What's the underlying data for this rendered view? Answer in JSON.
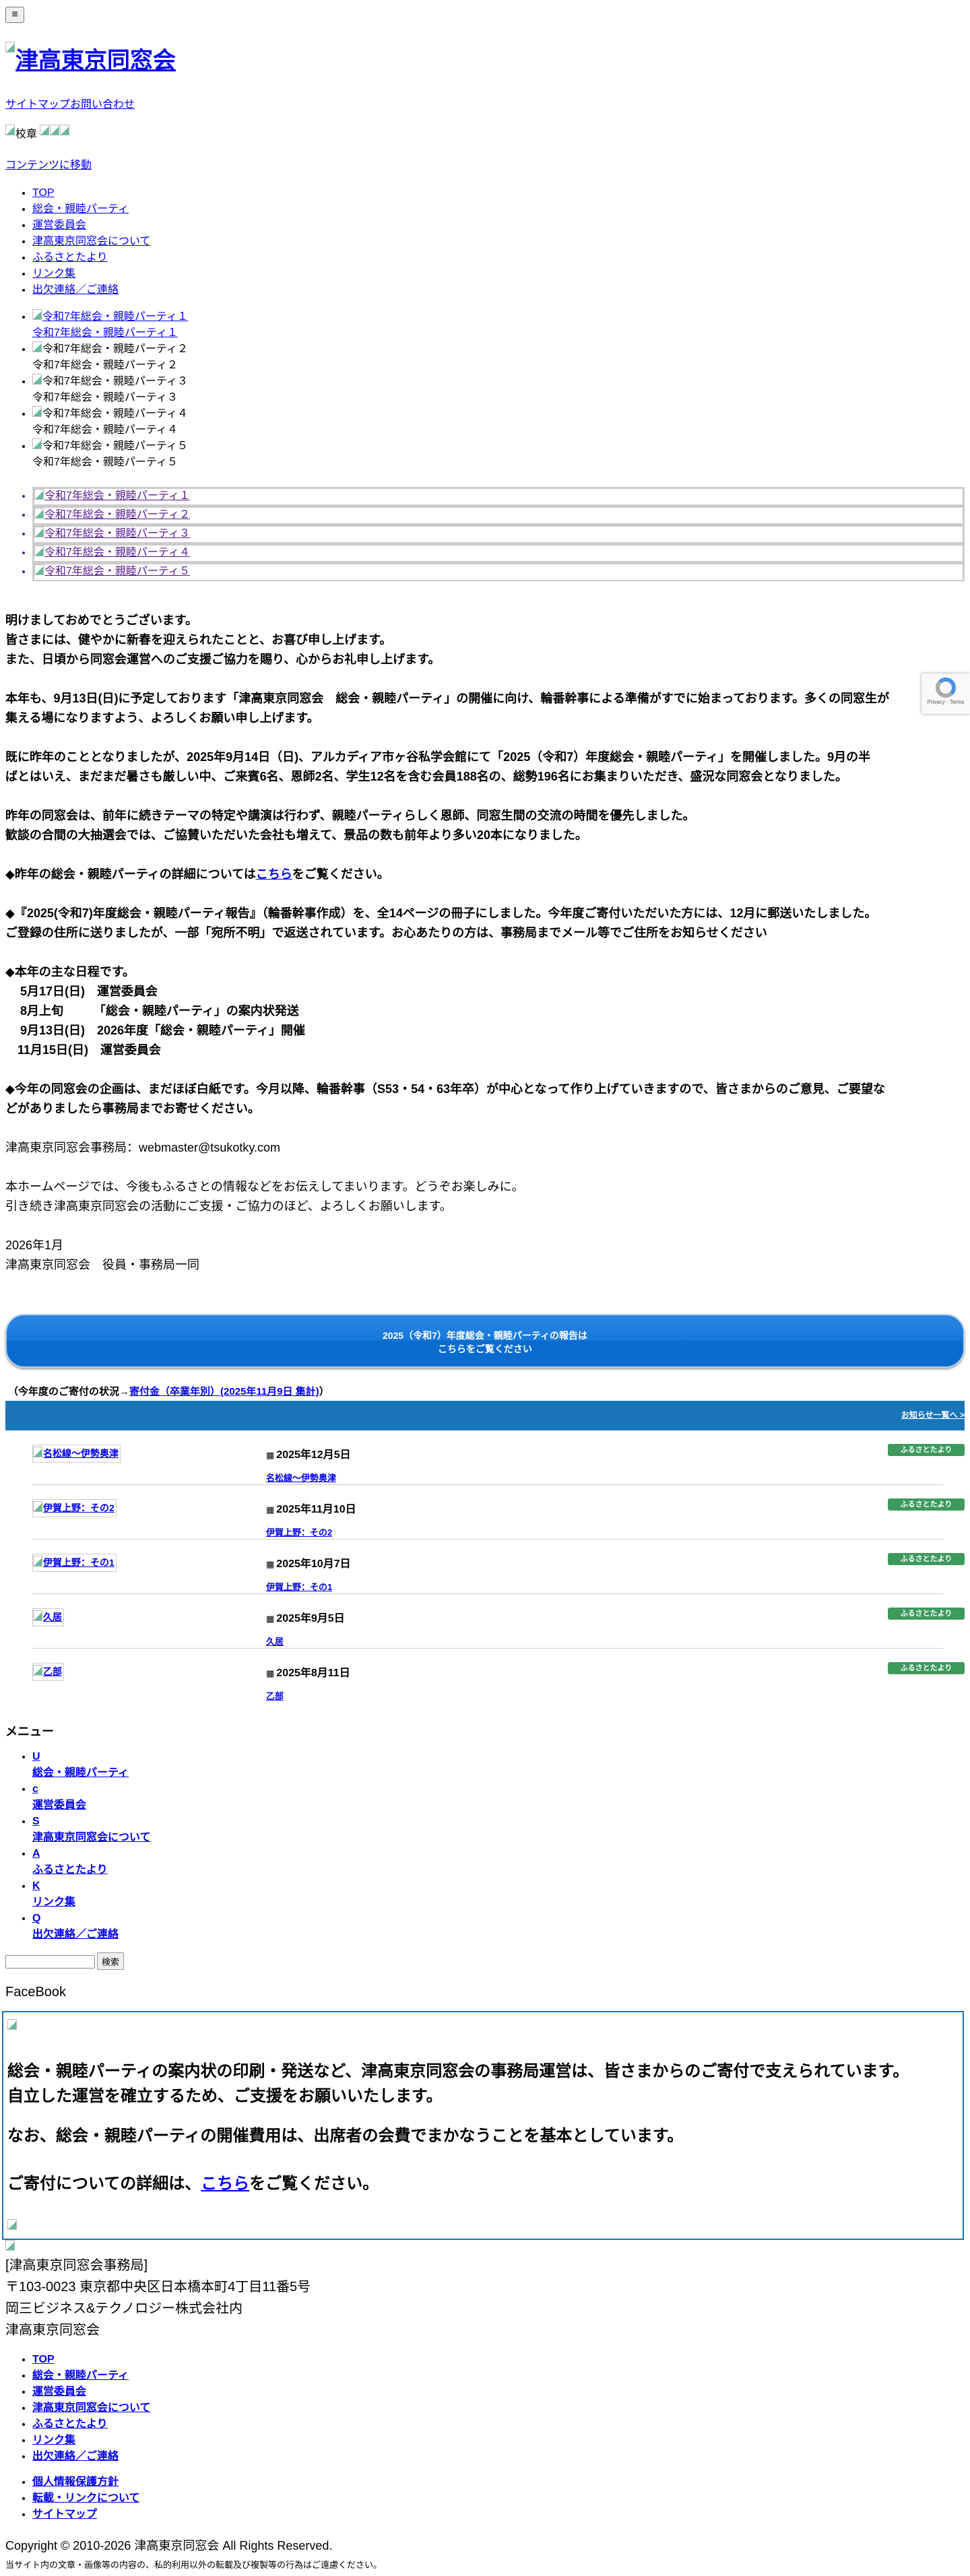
{
  "header": {
    "menu_button": "≡",
    "logo_text": "津高東京同窓会",
    "top_links": [
      "サイトマップ",
      "お問い合わせ"
    ],
    "crest_alt": "校章",
    "skip_link": "コンテンツに移動"
  },
  "nav": [
    "TOP",
    "総会・親睦パーティ",
    "運営委員会",
    "津高東京同窓会について",
    "ふるさとたより",
    "リンク集",
    "出欠連絡／ご連絡"
  ],
  "slides": [
    {
      "alt": "令和7年総会・親睦パーティ１",
      "caption": "令和7年総会・親睦パーティ１"
    },
    {
      "alt": "令和7年総会・親睦パーティ２",
      "caption": "令和7年総会・親睦パーティ２"
    },
    {
      "alt": "令和7年総会・親睦パーティ３",
      "caption": "令和7年総会・親睦パーティ３"
    },
    {
      "alt": "令和7年総会・親睦パーティ４",
      "caption": "令和7年総会・親睦パーティ４"
    },
    {
      "alt": "令和7年総会・親睦パーティ５",
      "caption": "令和7年総会・親睦パーティ５"
    }
  ],
  "thumbs": [
    "令和7年総会・親睦パーティ１",
    "令和7年総会・親睦パーティ２",
    "令和7年総会・親睦パーティ３",
    "令和7年総会・親睦パーティ４",
    "令和7年総会・親睦パーティ５"
  ],
  "main": {
    "p1": [
      "明けましておめでとうございます。",
      "皆さまには、健やかに新春を迎えられたことと、お喜び申し上げます。",
      "また、日頃から同窓会運営へのご支援ご協力を賜り、心からお礼申し上げます。"
    ],
    "p2": [
      "本年も、9月13日(日)に予定しております「津高東京同窓会　総会・親睦パーティ」の開催に向け、輪番幹事による準備がすでに始まっております。多くの同窓生が",
      "集える場になりますよう、よろしくお願い申し上げます。"
    ],
    "p3": [
      "既に昨年のこととなりましたが、2025年9月14日（日)、アルカディア市ヶ谷私学会館にて「2025（令和7）年度総会・親睦パーティ」を開催しました。9月の半",
      "ばとはいえ、まだまだ暑さも厳しい中、ご来賓6名、恩師2名、学生12名を含む会員188名の、総勢196名にお集まりいただき、盛況な同窓会となりました。"
    ],
    "p4": [
      "昨年の同窓会は、前年に続きテーマの特定や講演は行わず、親睦パーティらしく恩師、同窓生間の交流の時間を優先しました。",
      "歓談の合間の大抽選会では、ご協賛いただいた会社も増えて、景品の数も前年より多い20本になりました。"
    ],
    "p5_before": "◆昨年の総会・親睦パーティの詳細については",
    "p5_link": "こちら",
    "p5_after": "をご覧ください。",
    "p6": [
      "◆『2025(令和7)年度総会・親睦パーティ報告』（輪番幹事作成）を、全14ページの冊子にしました。今年度ご寄付いただいた方には、12月に郵送いたしました。",
      "ご登録の住所に送りましたが、一部「宛所不明」で返送されています。お心あたりの方は、事務局までメール等でご住所をお知らせください"
    ],
    "schedule_title": "◆本年の主な日程です。",
    "schedule": [
      "5月17日(日)　運営委員会",
      "8月上旬　　　「総会・親睦パーティ」の案内状発送",
      "9月13日(日)　2026年度「総会・親睦パーティ」開催",
      "11月15日(日)　運営委員会"
    ],
    "p7": [
      "◆今年の同窓会の企画は、まだほぼ白紙です。今月以降、輪番幹事（S53・54・63年卒）が中心となって作り上げていきますので、皆さまからのご意見、ご要望な",
      "どがありましたら事務局までお寄せください。"
    ],
    "email_line": "津高東京同窓会事務局：webmaster@tsukotky.com",
    "p8": [
      "本ホームページでは、今後もふるさとの情報などをお伝えしてまいります。どうぞお楽しみに。",
      "引き続き津高東京同窓会の活動にご支援・ご協力のほど、よろしくお願いします。"
    ],
    "date": "2026年1月",
    "signature": "津高東京同窓会　役員・事務局一同"
  },
  "recaptcha": {
    "links": "Privacy - Terms"
  },
  "report_button": {
    "line1": "2025（令和7）年度総会・親睦パーティの報告は",
    "line2": "こちらをご覧ください"
  },
  "donation_status": {
    "prefix": "（今年度のご寄付の状況→",
    "link": "寄付金（卒業年別）(2025年11月9日 集計)",
    "suffix": "）"
  },
  "news": {
    "more_link": "お知らせ一覧へ >",
    "items": [
      {
        "thumb": "名松線〜伊勢奥津",
        "date": "2025年12月5日",
        "title": "名松線〜伊勢奥津",
        "badge": "ふるさとたより"
      },
      {
        "thumb": "伊賀上野：その2",
        "date": "2025年11月10日",
        "title": "伊賀上野：その2",
        "badge": "ふるさとたより"
      },
      {
        "thumb": "伊賀上野：その1",
        "date": "2025年10月7日",
        "title": "伊賀上野：その1",
        "badge": "ふるさとたより"
      },
      {
        "thumb": "久居",
        "date": "2025年9月5日",
        "title": "久居",
        "badge": "ふるさとたより"
      },
      {
        "thumb": "乙部",
        "date": "2025年8月11日",
        "title": "乙部",
        "badge": "ふるさとたより"
      }
    ]
  },
  "menu": {
    "heading": "メニュー",
    "items": [
      {
        "icon": "U",
        "label": "総会・親睦パーティ"
      },
      {
        "icon": "c",
        "label": "運営委員会"
      },
      {
        "icon": "S",
        "label": "津高東京同窓会について"
      },
      {
        "icon": "A",
        "label": "ふるさとたより"
      },
      {
        "icon": "K",
        "label": "リンク集"
      },
      {
        "icon": "Q",
        "label": "出欠連絡／ご連絡"
      }
    ]
  },
  "search": {
    "value": "",
    "button": "検索"
  },
  "facebook_heading": "FaceBook",
  "donation_box": {
    "l1": "総会・親睦パーティの案内状の印刷・発送など、津高東京同窓会の事務局運営は、皆さまからのご寄付で支えられています。",
    "l2": "自立した運営を確立するため、ご支援をお願いいたします。",
    "l3": "なお、総会・親睦パーティの開催費用は、出席者の会費でまかなうことを基本としています。",
    "l4_before": "ご寄付についての詳細は、",
    "l4_link": "こちら",
    "l4_after": "をご覧ください。"
  },
  "address": [
    "[津高東京同窓会事務局]",
    "〒103-0023 東京都中央区日本橋本町4丁目11番5号",
    "岡三ビジネス&テクノロジー株式会社内",
    "津高東京同窓会"
  ],
  "footer_nav": [
    "TOP",
    "総会・親睦パーティ",
    "運営委員会",
    "津高東京同窓会について",
    "ふるさとたより",
    "リンク集",
    "出欠連絡／ご連絡"
  ],
  "footer_nav2": [
    "個人情報保護方針",
    "転載・リンクについて",
    "サイトマップ"
  ],
  "copyright": "Copyright © 2010-2026 津高東京同窓会 All Rights Reserved.",
  "notice": "当サイト内の文章・画像等の内容の、私的利用以外の転載及び複製等の行為はご遠慮ください。"
}
